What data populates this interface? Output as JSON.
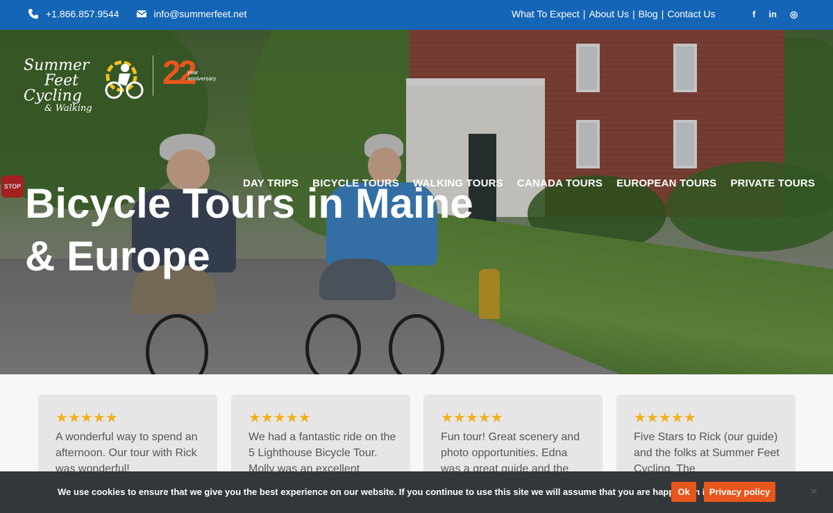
{
  "topbar": {
    "phone": "+1.866.857.9544",
    "email": "info@summerfeet.net",
    "links": [
      "What To Expect",
      "|",
      "About Us",
      "|",
      "Blog",
      "|",
      "Contact Us"
    ],
    "social": [
      "facebook-icon",
      "linkedin-icon",
      "instagram-icon"
    ],
    "social_glyphs": [
      "f",
      "in",
      "◎"
    ],
    "background": "#1565b6"
  },
  "logo": {
    "line1": "Summer",
    "line2": "Feet",
    "line3": "Cycling",
    "line4": "& Walking",
    "anniversary_number": "22",
    "anniversary_text1": "year",
    "anniversary_text2": "anniversary"
  },
  "nav": [
    "DAY TRIPS",
    "BICYCLE TOURS",
    "WALKING TOURS",
    "CANADA TOURS",
    "EUROPEAN TOURS",
    "PRIVATE TOURS"
  ],
  "hero": {
    "headline_line1": "Bicycle Tours in Maine",
    "headline_line2": "& Europe",
    "stop_sign": "STOP"
  },
  "reviews": [
    {
      "stars": "★★★★★",
      "text": "A wonderful way to spend an afternoon. Our tour with Rick was wonderful!"
    },
    {
      "stars": "★★★★★",
      "text": "We had a fantastic ride on the 5 Lighthouse Bicycle Tour. Molly was an excellent"
    },
    {
      "stars": "★★★★★",
      "text": "Fun tour! Great scenery and photo opportunities. Edna was a great guide and the"
    },
    {
      "stars": "★★★★★",
      "text": "Five Stars to Rick (our guide) and the folks at Summer Feet Cycling. The"
    }
  ],
  "cookie": {
    "message": "We use cookies to ensure that we give you the best experience on our website. If you continue to use this site we will assume that you are happy with it.",
    "ok_label": "Ok",
    "privacy_label": "Privacy policy",
    "close_label": "×",
    "button_color": "#e8561b"
  }
}
